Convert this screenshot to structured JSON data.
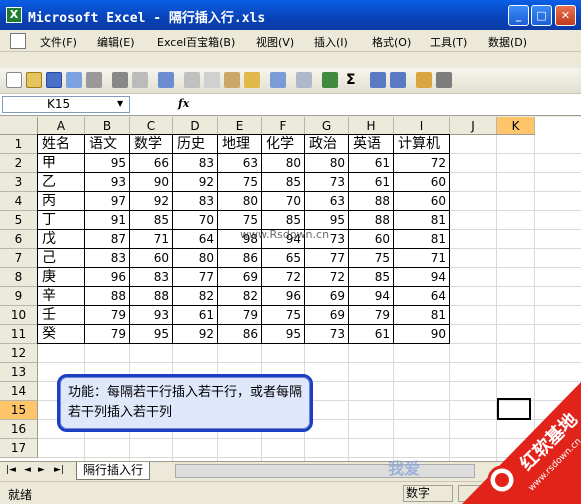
{
  "window": {
    "title": "Microsoft Excel - 隔行插入行.xls",
    "min": "_",
    "max": "□",
    "close": "✕"
  },
  "menu": [
    {
      "label": "文件(F)"
    },
    {
      "label": "编辑(E)"
    },
    {
      "label": "Excel百宝箱(B)"
    },
    {
      "label": "视图(V)"
    },
    {
      "label": "插入(I)"
    },
    {
      "label": "格式(O)"
    },
    {
      "label": "工具(T)"
    },
    {
      "label": "数据(D)"
    }
  ],
  "formula_bar": {
    "name_box": "K15",
    "fx": "fx",
    "content": ""
  },
  "columns": [
    "A",
    "B",
    "C",
    "D",
    "E",
    "F",
    "G",
    "H",
    "I",
    "J",
    "K"
  ],
  "rows": [
    "1",
    "2",
    "3",
    "4",
    "5",
    "6",
    "7",
    "8",
    "9",
    "10",
    "11",
    "12",
    "13",
    "14",
    "15",
    "16",
    "17"
  ],
  "active_cell": {
    "col": "K",
    "row": "15"
  },
  "table": {
    "headers": [
      "姓名",
      "语文",
      "数学",
      "历史",
      "地理",
      "化学",
      "政治",
      "英语",
      "计算机"
    ],
    "rows": [
      [
        "甲",
        "95",
        "66",
        "83",
        "63",
        "80",
        "80",
        "61",
        "72"
      ],
      [
        "乙",
        "93",
        "90",
        "92",
        "75",
        "85",
        "73",
        "61",
        "60"
      ],
      [
        "丙",
        "97",
        "92",
        "83",
        "80",
        "70",
        "63",
        "88",
        "60"
      ],
      [
        "丁",
        "91",
        "85",
        "70",
        "75",
        "85",
        "95",
        "88",
        "81"
      ],
      [
        "戊",
        "87",
        "71",
        "64",
        "98",
        "94",
        "73",
        "60",
        "81"
      ],
      [
        "己",
        "83",
        "60",
        "80",
        "86",
        "65",
        "77",
        "75",
        "71"
      ],
      [
        "庚",
        "96",
        "83",
        "77",
        "69",
        "72",
        "72",
        "85",
        "94"
      ],
      [
        "辛",
        "88",
        "88",
        "82",
        "82",
        "96",
        "69",
        "94",
        "64"
      ],
      [
        "壬",
        "79",
        "93",
        "61",
        "79",
        "75",
        "69",
        "79",
        "81"
      ],
      [
        "癸",
        "79",
        "95",
        "92",
        "86",
        "95",
        "73",
        "61",
        "90"
      ]
    ]
  },
  "callout": {
    "text": "功能：每隔若干行插入若干行，或者每隔若干列插入若干列"
  },
  "sheet_tabs": {
    "nav": [
      "|◄",
      "◄",
      "►",
      "►|"
    ],
    "active": "隔行插入行"
  },
  "status": {
    "ready": "就绪",
    "num": "数字"
  },
  "watermark": {
    "center": "www.Rsdown.cn",
    "brand": "红软基地",
    "url": "www.rsdown.cn",
    "bottom": "我爱"
  }
}
